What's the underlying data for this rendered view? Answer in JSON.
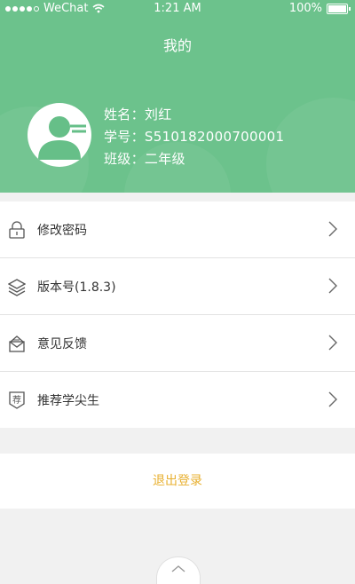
{
  "status_bar": {
    "carrier": "WeChat",
    "time": "1:21 AM",
    "battery": "100%"
  },
  "header": {
    "title": "我的"
  },
  "profile": {
    "name_line": "姓名：刘红",
    "student_id_line": "学号：S510182000700001",
    "grade_line": "班级：二年级"
  },
  "menu": {
    "items": [
      {
        "label": "修改密码",
        "icon": "lock-icon"
      },
      {
        "label": "版本号(1.8.3)",
        "icon": "layers-icon"
      },
      {
        "label": "意见反馈",
        "icon": "feedback-icon"
      },
      {
        "label": "推荐学尖生",
        "icon": "recommend-badge-icon"
      }
    ]
  },
  "logout": {
    "label": "退出登录"
  },
  "colors": {
    "header_green": "#6cc28c",
    "logout_text": "#e8b030"
  }
}
